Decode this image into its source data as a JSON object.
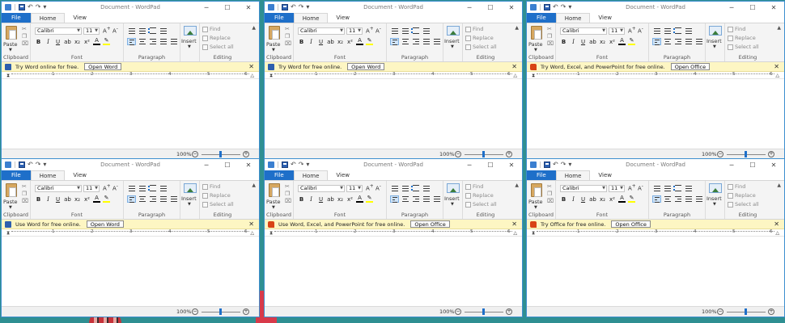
{
  "windows": [
    {
      "title": "Document - WordPad",
      "tabs": [
        "File",
        "Home",
        "View"
      ],
      "clipboard": {
        "paste_label": "Paste",
        "group_label": "Clipboard"
      },
      "font": {
        "name": "Calibri",
        "size": "11",
        "group_label": "Font"
      },
      "paragraph": {
        "group_label": "Paragraph"
      },
      "insert": {
        "label": "Insert"
      },
      "editing": {
        "find": "Find",
        "replace": "Replace",
        "select_all": "Select all",
        "group_label": "Editing"
      },
      "notification": {
        "icon": "word-icon",
        "text": "Try Word online for free.",
        "button": "Open Word"
      },
      "ruler": [
        "1",
        "2",
        "3",
        "4",
        "5",
        "6"
      ],
      "zoom": "100%"
    },
    {
      "title": "Document - WordPad",
      "tabs": [
        "File",
        "Home",
        "View"
      ],
      "clipboard": {
        "paste_label": "Paste",
        "group_label": "Clipboard"
      },
      "font": {
        "name": "Calibri",
        "size": "11",
        "group_label": "Font"
      },
      "paragraph": {
        "group_label": "Paragraph"
      },
      "insert": {
        "label": "Insert"
      },
      "editing": {
        "find": "Find",
        "replace": "Replace",
        "select_all": "Select all",
        "group_label": "Editing"
      },
      "notification": {
        "icon": "word-icon",
        "text": "Try Word for free online.",
        "button": "Open Word"
      },
      "ruler": [
        "1",
        "2",
        "3",
        "4",
        "5",
        "6"
      ],
      "zoom": "100%"
    },
    {
      "title": "Document - WordPad",
      "tabs": [
        "File",
        "Home",
        "View"
      ],
      "clipboard": {
        "paste_label": "Paste",
        "group_label": "Clipboard"
      },
      "font": {
        "name": "Calibri",
        "size": "11",
        "group_label": "Font"
      },
      "paragraph": {
        "group_label": "Paragraph"
      },
      "insert": {
        "label": "Insert"
      },
      "editing": {
        "find": "Find",
        "replace": "Replace",
        "select_all": "Select all",
        "group_label": "Editing"
      },
      "notification": {
        "icon": "office-icon",
        "text": "Try Word, Excel, and PowerPoint for free online.",
        "button": "Open Office"
      },
      "ruler": [
        "1",
        "2",
        "3",
        "4",
        "5",
        "6"
      ],
      "zoom": "100%"
    },
    {
      "title": "Document - WordPad",
      "tabs": [
        "File",
        "Home",
        "View"
      ],
      "clipboard": {
        "paste_label": "Paste",
        "group_label": "Clipboard"
      },
      "font": {
        "name": "Calibri",
        "size": "11",
        "group_label": "Font"
      },
      "paragraph": {
        "group_label": "Paragraph"
      },
      "insert": {
        "label": "Insert"
      },
      "editing": {
        "find": "Find",
        "replace": "Replace",
        "select_all": "Select all",
        "group_label": "Editing"
      },
      "notification": {
        "icon": "word-icon",
        "text": "Use Word for free online.",
        "button": "Open Word"
      },
      "ruler": [
        "1",
        "2",
        "3",
        "4",
        "5",
        "6"
      ],
      "zoom": "100%"
    },
    {
      "title": "Document - WordPad",
      "tabs": [
        "File",
        "Home",
        "View"
      ],
      "clipboard": {
        "paste_label": "Paste",
        "group_label": "Clipboard"
      },
      "font": {
        "name": "Calibri",
        "size": "11",
        "group_label": "Font"
      },
      "paragraph": {
        "group_label": "Paragraph"
      },
      "insert": {
        "label": "Insert"
      },
      "editing": {
        "find": "Find",
        "replace": "Replace",
        "select_all": "Select all",
        "group_label": "Editing"
      },
      "notification": {
        "icon": "office-icon",
        "text": "Use Word, Excel, and PowerPoint for free online.",
        "button": "Open Office"
      },
      "ruler": [
        "1",
        "2",
        "3",
        "4",
        "5",
        "6"
      ],
      "zoom": "100%"
    },
    {
      "title": "Document - WordPad",
      "tabs": [
        "File",
        "Home",
        "View"
      ],
      "clipboard": {
        "paste_label": "Paste",
        "group_label": "Clipboard"
      },
      "font": {
        "name": "Calibri",
        "size": "11",
        "group_label": "Font"
      },
      "paragraph": {
        "group_label": "Paragraph"
      },
      "insert": {
        "label": "Insert"
      },
      "editing": {
        "find": "Find",
        "replace": "Replace",
        "select_all": "Select all",
        "group_label": "Editing"
      },
      "notification": {
        "icon": "office-icon",
        "text": "Try Office for free online.",
        "button": "Open Office"
      },
      "ruler": [
        "1",
        "2",
        "3",
        "4",
        "5",
        "6"
      ],
      "zoom": "100%"
    }
  ],
  "colors": {
    "desktop": "#2f8f92",
    "accent": "#1e6fc9",
    "notification_bg": "#fdf6c3"
  }
}
